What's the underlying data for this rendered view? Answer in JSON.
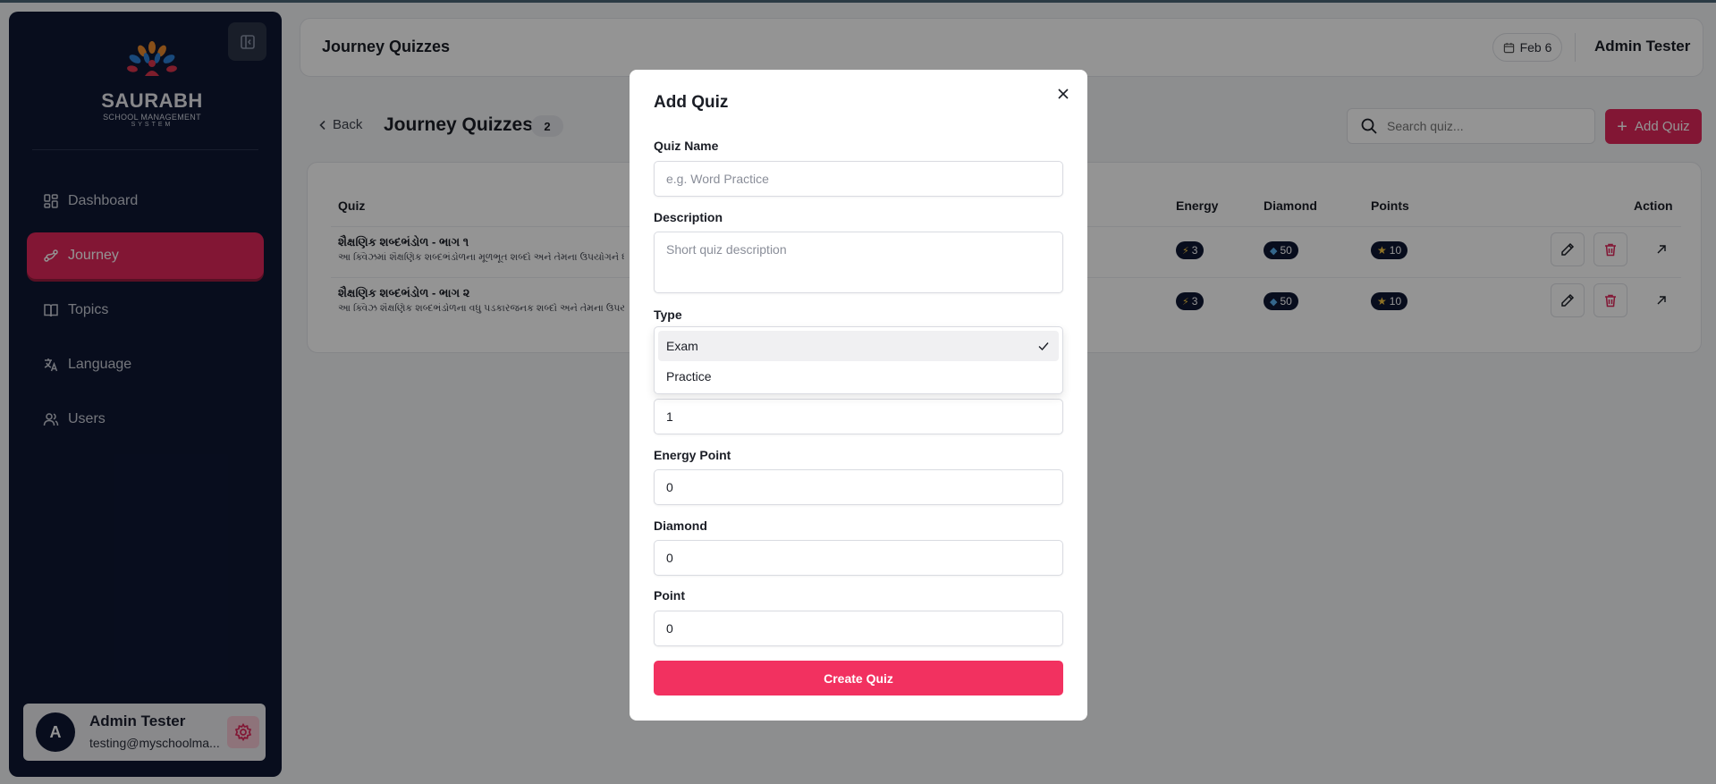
{
  "sidebar": {
    "logo": {
      "name": "SAURABH",
      "subtitle": "SCHOOL MANAGEMENT",
      "subtitle2": "SYSTEM"
    },
    "items": [
      {
        "label": "Dashboard",
        "icon": "dashboard-icon",
        "active": false
      },
      {
        "label": "Journey",
        "icon": "journey-icon",
        "active": true
      },
      {
        "label": "Topics",
        "icon": "book-icon",
        "active": false
      },
      {
        "label": "Language",
        "icon": "translate-icon",
        "active": false
      },
      {
        "label": "Users",
        "icon": "users-icon",
        "active": false
      }
    ],
    "user": {
      "initial": "A",
      "name": "Admin Tester",
      "email": "testing@myschoolma..."
    }
  },
  "header": {
    "title": "Journey Quizzes",
    "date": "Feb 6",
    "user": "Admin Tester"
  },
  "subheader": {
    "back_label": "Back",
    "title": "Journey Quizzes",
    "count": "2",
    "search_placeholder": "Search quiz...",
    "add_label": "Add Quiz"
  },
  "table": {
    "columns": {
      "quiz": "Quiz",
      "energy": "Energy",
      "diamond": "Diamond",
      "points": "Points",
      "action": "Action"
    },
    "rows": [
      {
        "title": "શૈક્ષણિક શબ્દભંડોળ - ભાગ ૧",
        "description": "આ ક્વિઝમાં શૈક્ષણિક શબ્દભંડોળના મૂળભૂત શબ્દો અને તેમના ઉપયોગને ધ્યાનમાં",
        "energy": "3",
        "diamond": "50",
        "points": "10"
      },
      {
        "title": "શૈક્ષણિક શબ્દભંડોળ - ભાગ ૨",
        "description": "આ ક્વિઝ શૈક્ષણિક શબ્દભંડોળના વધુ પડકારજનક શબ્દો અને તેમના ઉપયોગ પ",
        "energy": "3",
        "diamond": "50",
        "points": "10"
      }
    ]
  },
  "modal": {
    "title": "Add Quiz",
    "quiz_name_label": "Quiz Name",
    "quiz_name_placeholder": "e.g. Word Practice",
    "description_label": "Description",
    "description_placeholder": "Short quiz description",
    "type_label": "Type",
    "type_options": [
      "Exam",
      "Practice"
    ],
    "type_selected": "Exam",
    "order_value": "1",
    "energy_label": "Energy Point",
    "energy_value": "0",
    "diamond_label": "Diamond",
    "diamond_value": "0",
    "point_label": "Point",
    "point_value": "0",
    "submit_label": "Create Quiz"
  },
  "colors": {
    "accent": "#e0265a",
    "sidebar_bg": "#0e1733",
    "submit": "#f23160"
  }
}
